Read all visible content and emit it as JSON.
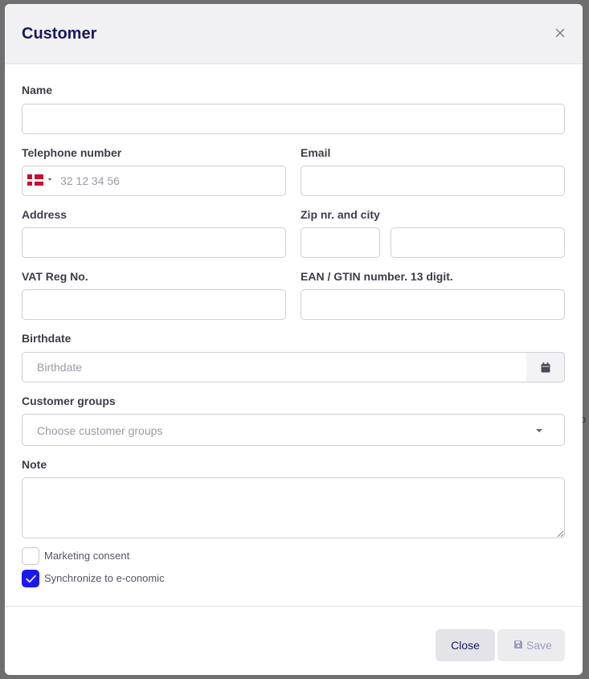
{
  "modal": {
    "title": "Customer"
  },
  "background": {
    "partial_text": "o"
  },
  "form": {
    "name": {
      "label": "Name",
      "value": ""
    },
    "telephone": {
      "label": "Telephone number",
      "placeholder": "32 12 34 56",
      "country_flag": "denmark-flag-icon"
    },
    "email": {
      "label": "Email",
      "value": ""
    },
    "address": {
      "label": "Address",
      "value": ""
    },
    "zip_city": {
      "label": "Zip nr. and city",
      "zip": "",
      "city": ""
    },
    "vat": {
      "label": "VAT Reg No.",
      "value": ""
    },
    "ean": {
      "label": "EAN / GTIN number. 13 digit.",
      "value": ""
    },
    "birthdate": {
      "label": "Birthdate",
      "placeholder": "Birthdate",
      "icon": "calendar-icon"
    },
    "customer_groups": {
      "label": "Customer groups",
      "placeholder": "Choose customer groups"
    },
    "note": {
      "label": "Note",
      "value": ""
    },
    "marketing_consent": {
      "label": "Marketing consent",
      "checked": false
    },
    "sync_economic": {
      "label": "Synchronize to e-conomic",
      "checked": true
    }
  },
  "footer": {
    "close_label": "Close",
    "save_label": "Save"
  },
  "colors": {
    "title": "#171763",
    "checkbox_checked": "#1a1aef",
    "header_bg": "#f1f1f4",
    "save_disabled_text": "#9b9bc4"
  }
}
